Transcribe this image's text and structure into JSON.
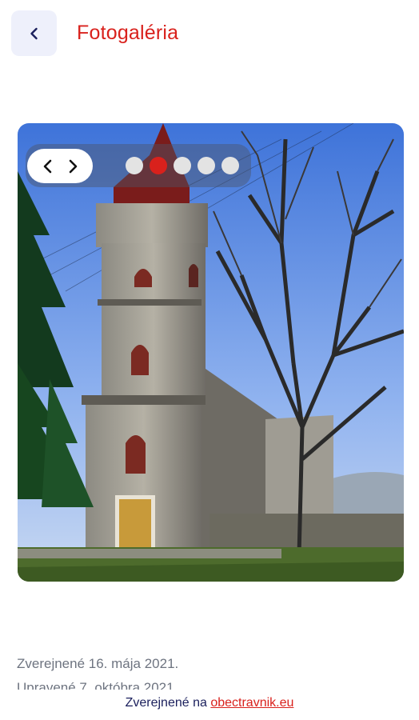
{
  "header": {
    "title": "Fotogaléria"
  },
  "gallery": {
    "active_index": 1,
    "dots": [
      "1",
      "2",
      "3",
      "4",
      "5"
    ]
  },
  "meta": {
    "published": "Zverejnené 16. mája 2021.",
    "updated": "Upravené 7. októbra 2021."
  },
  "footer": {
    "prefix": "Zverejnené na",
    "link": "obectravnik.eu"
  },
  "colors": {
    "accent": "#d9211c",
    "back_bg": "#eef0fb",
    "footer_text": "#1a1f5c"
  },
  "icons": {
    "back": "chevron-left-icon",
    "prev": "chevron-left-icon",
    "next": "chevron-right-icon"
  }
}
